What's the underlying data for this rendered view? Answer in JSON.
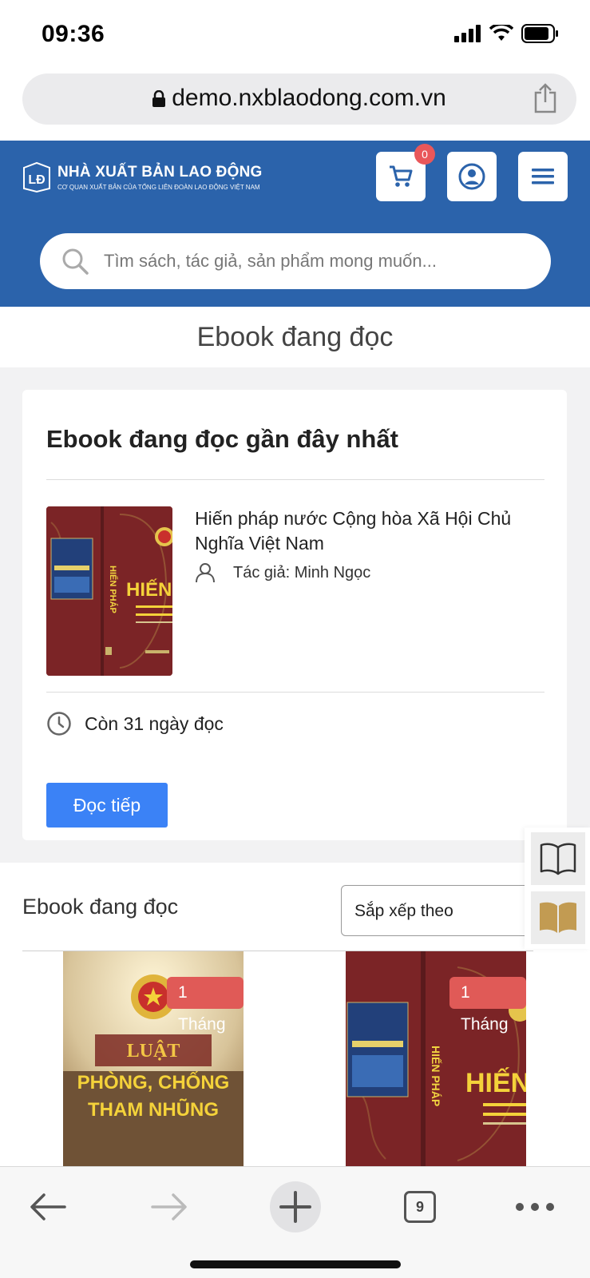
{
  "status_bar": {
    "time": "09:36"
  },
  "browser": {
    "url": "demo.nxblaodong.com.vn",
    "tab_count": "9"
  },
  "header": {
    "logo_title": "NHÀ XUẤT BẢN LAO ĐỘNG",
    "logo_subtitle": "CƠ QUAN XUẤT BẢN CỦA TỔNG LIÊN ĐOÀN LAO ĐỘNG VIỆT NAM",
    "cart_count": "0",
    "brand_color": "#2b63ab"
  },
  "search": {
    "placeholder": "Tìm sách, tác giả, sản phẩm mong muốn..."
  },
  "page_title": "Ebook đang đọc",
  "recent_card": {
    "title": "Ebook đang đọc gần đây nhất",
    "book_title": "Hiến pháp nước Cộng hòa Xã Hội Chủ Nghĩa Việt Nam",
    "author": "Tác giả: Minh Ngọc",
    "days_left": "Còn 31 ngày đọc",
    "read_button": "Đọc tiếp",
    "cover_spine_text": "HIẾN PHÁP",
    "cover_title": "HIẾN PHÁP"
  },
  "list": {
    "title": "Ebook đang đọc",
    "sort_label": "Sắp xếp theo",
    "books": [
      {
        "tag": "1 Tháng",
        "cover_line1": "LUẬT",
        "cover_line2": "PHÒNG, CHỐNG",
        "cover_line3": "THAM NHŨNG"
      },
      {
        "tag": "1 Tháng",
        "cover_spine_text": "HIẾN PHÁP",
        "cover_title": "HIẾN"
      }
    ]
  },
  "icons": {
    "cart": "cart-icon",
    "account": "user-circle-icon",
    "menu": "hamburger-icon",
    "search": "search-icon",
    "author": "person-icon",
    "clock": "clock-icon",
    "book_open": "book-open-icon",
    "book_closed": "book-icon",
    "back": "arrow-left-icon",
    "forward": "arrow-right-icon",
    "new_tab": "plus-icon",
    "more": "more-icon"
  }
}
